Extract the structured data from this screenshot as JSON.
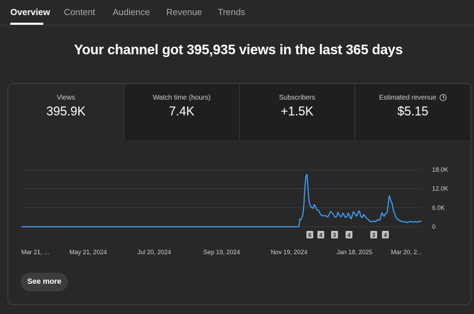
{
  "tabs": [
    {
      "label": "Overview",
      "active": true
    },
    {
      "label": "Content",
      "active": false
    },
    {
      "label": "Audience",
      "active": false
    },
    {
      "label": "Revenue",
      "active": false
    },
    {
      "label": "Trends",
      "active": false
    }
  ],
  "headline": "Your channel got 395,935 views in the last 365 days",
  "metrics": [
    {
      "label": "Views",
      "value": "395.9K",
      "active": true
    },
    {
      "label": "Watch time (hours)",
      "value": "7.4K",
      "active": false
    },
    {
      "label": "Subscribers",
      "value": "+1.5K",
      "active": false
    },
    {
      "label": "Estimated revenue",
      "value": "$5.15",
      "active": false,
      "icon": "clock-icon"
    }
  ],
  "colors": {
    "line": "#3ea6ff",
    "background": "#282828",
    "tile": "#1f1f1f"
  },
  "chart_data": {
    "type": "line",
    "ylim": [
      0,
      18000
    ],
    "y_ticks": [
      "18.0K",
      "12.0K",
      "6.0K",
      "0"
    ],
    "x_ticks": [
      "Mar 21, ...",
      "May 21, 2024",
      "Jul 20, 2024",
      "Sep 19, 2024",
      "Nov 19, 2024",
      "Jan 18, 2025",
      "Mar 20, 2..."
    ],
    "grid": true,
    "series": [
      {
        "values": [
          0,
          0,
          0,
          0,
          0,
          0,
          0,
          0,
          0,
          0,
          0,
          0,
          0,
          0,
          0,
          0,
          0,
          0,
          0,
          0,
          0,
          0,
          0,
          0,
          0,
          0,
          0,
          0,
          0,
          0,
          0,
          0,
          0,
          0,
          0,
          0,
          0,
          0,
          0,
          0,
          0,
          0,
          0,
          0,
          0,
          0,
          0,
          0,
          0,
          0,
          0,
          0,
          0,
          0,
          0,
          0,
          0,
          0,
          0,
          0,
          0,
          0,
          0,
          0,
          0,
          0,
          0,
          0,
          0,
          0,
          0,
          0,
          0,
          0,
          0,
          0,
          0,
          0,
          0,
          0,
          0,
          0,
          0,
          0,
          0,
          0,
          0,
          0,
          0,
          0,
          0,
          0,
          0,
          0,
          0,
          0,
          0,
          0,
          0,
          0,
          0,
          0,
          0,
          0,
          0,
          0,
          0,
          0,
          0,
          0,
          0,
          0,
          0,
          0,
          0,
          0,
          0,
          0,
          0,
          0,
          0,
          0,
          0,
          0,
          0,
          0,
          0,
          0,
          0,
          0,
          0,
          0,
          0,
          0,
          0,
          0,
          0,
          0,
          0,
          0,
          0,
          0,
          0,
          0,
          0,
          0,
          0,
          0,
          0,
          0,
          0,
          0,
          0,
          0,
          0,
          0,
          0,
          0,
          0,
          0,
          0,
          0,
          0,
          0,
          0,
          0,
          0,
          0,
          0,
          0,
          0,
          0,
          0,
          0,
          0,
          0,
          0,
          0,
          0,
          0,
          0,
          0,
          0,
          0,
          0,
          0,
          0,
          0,
          0,
          0,
          0,
          0,
          0,
          0,
          0,
          0,
          0,
          0,
          0,
          0,
          0,
          0,
          0,
          0,
          0,
          0,
          0,
          0,
          0,
          0,
          0,
          0,
          0,
          0,
          0,
          0,
          0,
          0,
          0,
          0,
          0,
          0,
          0,
          0,
          0,
          0,
          0,
          0,
          0,
          0,
          0,
          0,
          0,
          0,
          0,
          0,
          0,
          0,
          0,
          0,
          0,
          0,
          0,
          0,
          0,
          0,
          0,
          0,
          0,
          0,
          0,
          0,
          0,
          0,
          0,
          0,
          0,
          0,
          0,
          0,
          0,
          0,
          0,
          0,
          0,
          0,
          0,
          0,
          0,
          0,
          0,
          2400,
          2200,
          2800,
          3800,
          7000,
          12500,
          16000,
          16500,
          12000,
          8000,
          6800,
          6200,
          6000,
          5800,
          7000,
          6600,
          5800,
          5200,
          5200,
          4600,
          4000,
          3600,
          3500,
          3500,
          3400,
          3500,
          3300,
          3100,
          3400,
          4200,
          4800,
          4600,
          4200,
          3700,
          3100,
          3000,
          3300,
          4600,
          4000,
          3500,
          3100,
          3600,
          4300,
          3800,
          3000,
          3000,
          3300,
          4300,
          3800,
          2900,
          2500,
          3600,
          4700,
          4400,
          3900,
          3300,
          3700,
          4800,
          5000,
          3700,
          3000,
          2900,
          3900,
          3500,
          3100,
          2700,
          2400,
          2200,
          1800,
          1600,
          1700,
          1600,
          1800,
          1600,
          1700,
          2000,
          2300,
          2100,
          2100,
          3500,
          4400,
          3700,
          3300,
          4000,
          4200,
          4500,
          7000,
          9800,
          8800,
          8000,
          7000,
          5200,
          4300,
          3500,
          2600,
          2500,
          2200,
          2000,
          1700,
          1800,
          1600,
          1500,
          1500,
          1600,
          1400,
          1300,
          1500,
          1600,
          1700,
          1500,
          1500,
          1500,
          1700,
          1500,
          1500,
          1500,
          1700,
          1600,
          1800
        ]
      }
    ],
    "markers": [
      "6",
      "4",
      "3",
      "4",
      "3",
      "4"
    ]
  },
  "see_more_label": "See more"
}
